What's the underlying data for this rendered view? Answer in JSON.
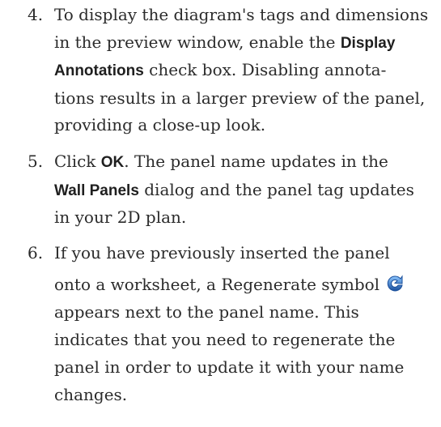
{
  "steps": [
    {
      "number": "4.",
      "lines": [
        [
          {
            "t": "To display the diagram's tags and dimensions"
          }
        ],
        [
          {
            "t": "in the preview window, enable the "
          },
          {
            "t": "Display",
            "ui": true
          }
        ],
        [
          {
            "t": "Annotations",
            "ui": true
          },
          {
            "t": " check box. Disabling annota-"
          }
        ],
        [
          {
            "t": "tions results in a larger preview of the panel,"
          }
        ],
        [
          {
            "t": "providing a close-up look."
          }
        ]
      ]
    },
    {
      "number": "5.",
      "lines": [
        [
          {
            "t": "Click "
          },
          {
            "t": "OK",
            "ui": true
          },
          {
            "t": ". The panel name updates in the"
          }
        ],
        [
          {
            "t": "Wall Panels",
            "ui": true
          },
          {
            "t": " dialog and the panel tag updates"
          }
        ],
        [
          {
            "t": "in your 2D plan."
          }
        ]
      ]
    },
    {
      "number": "6.",
      "lines": [
        [
          {
            "t": "If you have previously inserted the panel"
          }
        ],
        [
          {
            "t": "onto a worksheet, a Regenerate symbol"
          },
          {
            "icon": "regenerate-icon"
          }
        ],
        [
          {
            "t": "appears next to the panel name. This"
          }
        ],
        [
          {
            "t": "indicates that you need to regenerate the"
          }
        ],
        [
          {
            "t": "panel in order to update it with your name"
          }
        ],
        [
          {
            "t": "changes."
          }
        ]
      ]
    }
  ],
  "colors": {
    "text": "#2b2b2b",
    "icon_blue": "#2f7fd1",
    "icon_dark": "#1a4f9c"
  }
}
